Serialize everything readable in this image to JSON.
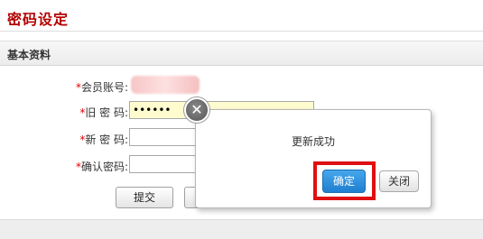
{
  "page": {
    "title": "密码设定"
  },
  "section": {
    "title": "基本资料"
  },
  "form": {
    "required_mark": "*",
    "account_label": "会员账号:",
    "old_password_label": "旧 密 码:",
    "old_password_value": "••••••",
    "new_password_label": "新 密 码:",
    "new_password_value": "",
    "confirm_password_label": "确认密码:",
    "confirm_password_value": ""
  },
  "buttons": {
    "submit_label": "提交",
    "reset_label": ""
  },
  "dialog": {
    "message": "更新成功",
    "close_glyph": "✕",
    "ok_label": "确定",
    "close_label": "关闭"
  },
  "colors": {
    "title": "#b30000",
    "required": "#e00000",
    "highlight": "#e01010",
    "ok_button": "#2a8ad8"
  }
}
